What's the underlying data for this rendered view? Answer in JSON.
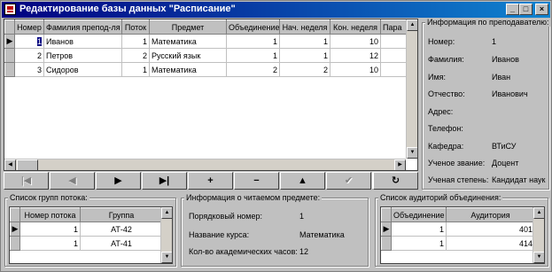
{
  "window": {
    "title": "Редактирование базы данных \"Расписание\"",
    "controls": [
      "_",
      "□",
      "×"
    ]
  },
  "main_grid": {
    "columns": [
      "Номер",
      "Фамилия препод-ля",
      "Поток",
      "Предмет",
      "Объединение",
      "Нач. неделя",
      "Кон. неделя",
      "Пара"
    ],
    "rows": [
      [
        "1",
        "Иванов",
        "1",
        "Математика",
        "1",
        "1",
        "10",
        ""
      ],
      [
        "2",
        "Петров",
        "2",
        "Русский язык",
        "1",
        "1",
        "12",
        ""
      ],
      [
        "3",
        "Сидоров",
        "1",
        "Математика",
        "2",
        "2",
        "10",
        ""
      ]
    ],
    "current_row_indicator": "▶"
  },
  "navigator": {
    "buttons": [
      {
        "name": "first",
        "glyph": "|◀"
      },
      {
        "name": "prior",
        "glyph": "◀"
      },
      {
        "name": "next",
        "glyph": "▶"
      },
      {
        "name": "last",
        "glyph": "▶|"
      },
      {
        "name": "insert",
        "glyph": "+"
      },
      {
        "name": "delete",
        "glyph": "−"
      },
      {
        "name": "edit",
        "glyph": "▲"
      },
      {
        "name": "post",
        "glyph": "✔"
      },
      {
        "name": "cancel",
        "glyph": "✕"
      },
      {
        "name": "refresh",
        "glyph": "↻"
      }
    ]
  },
  "teacher_info": {
    "caption": "Информация по преподавателю:",
    "fields": [
      {
        "label": "Номер:",
        "value": "1"
      },
      {
        "label": "Фамилия:",
        "value": "Иванов"
      },
      {
        "label": "Имя:",
        "value": "Иван"
      },
      {
        "label": "Отчество:",
        "value": "Иванович"
      },
      {
        "label": "Адрес:",
        "value": ""
      },
      {
        "label": "Телефон:",
        "value": ""
      },
      {
        "label": "Кафедра:",
        "value": "ВТиСУ"
      },
      {
        "label": "Ученое звание:",
        "value": "Доцент"
      },
      {
        "label": "Ученая степень:",
        "value": "Кандидат наук"
      }
    ]
  },
  "groups": {
    "caption": "Список групп потока:",
    "columns": [
      "Номер потока",
      "Группа"
    ],
    "rows": [
      [
        "1",
        "АТ-42"
      ],
      [
        "1",
        "АТ-41"
      ]
    ]
  },
  "subject_info": {
    "caption": "Информация о читаемом предмете:",
    "fields": [
      {
        "label": "Порядковый номер:",
        "value": "1"
      },
      {
        "label": "Название курса:",
        "value": "Математика"
      },
      {
        "label": "Кол-во академических часов:",
        "value": "12"
      }
    ]
  },
  "rooms": {
    "caption": "Список аудиторий объединения:",
    "columns": [
      "Объединение",
      "Аудитория"
    ],
    "rows": [
      [
        "1",
        "401"
      ],
      [
        "1",
        "414"
      ]
    ]
  },
  "scroll": {
    "up": "▲",
    "down": "▼",
    "left": "◀",
    "right": "▶"
  }
}
